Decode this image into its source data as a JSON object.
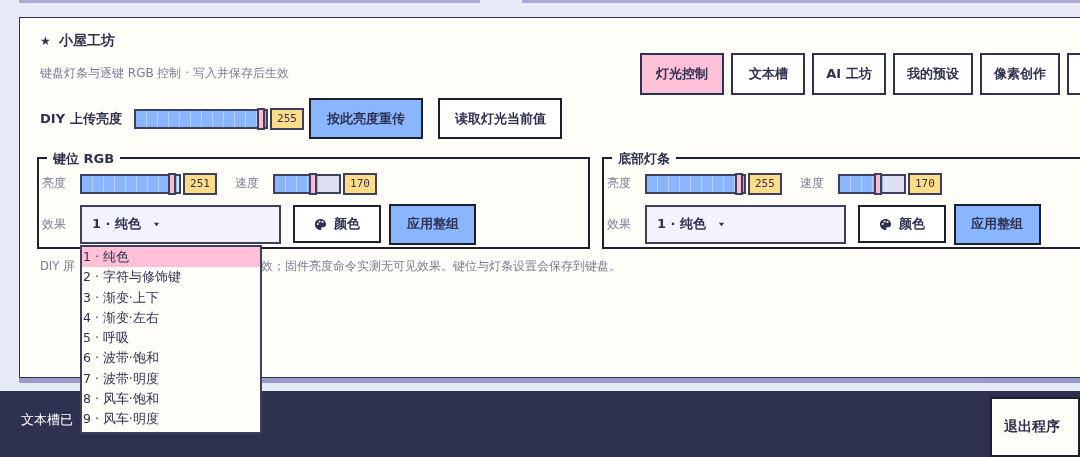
{
  "header": {
    "icon": "★",
    "title": "小屋工坊",
    "subtitle": "键盘灯条与逐键 RGB 控制 · 写入并保存后生效"
  },
  "tabs": [
    {
      "label": "灯光控制",
      "selected": true
    },
    {
      "label": "文本槽",
      "selected": false
    },
    {
      "label": "AI 工坊",
      "selected": false
    },
    {
      "label": "我的预设",
      "selected": false
    },
    {
      "label": "像素创作",
      "selected": false
    }
  ],
  "diy": {
    "label": "DIY 上传亮度",
    "level": 1.0,
    "value": "255",
    "buttons": [
      {
        "label": "按此亮度重传",
        "kind": "primary"
      },
      {
        "label": "读取灯光当前值",
        "kind": "plain"
      }
    ]
  },
  "groups": [
    {
      "title": "键位 RGB",
      "brightness": {
        "label": "亮度",
        "level": 0.984,
        "value": "251"
      },
      "speed": {
        "label": "速度",
        "level": 0.667,
        "value": "170"
      },
      "effect": {
        "label": "效果",
        "value": "1 · 纯色",
        "expanded": true
      },
      "color_button": "颜色",
      "apply_button": "应用整组"
    },
    {
      "title": "底部灯条",
      "brightness": {
        "label": "亮度",
        "level": 1.0,
        "value": "255"
      },
      "speed": {
        "label": "速度",
        "level": 0.667,
        "value": "170"
      },
      "effect": {
        "label": "效果",
        "value": "1 · 纯色",
        "expanded": false
      },
      "color_button": "颜色",
      "apply_button": "应用整组"
    }
  ],
  "dropdown": {
    "options": [
      {
        "label": "1 · 纯色",
        "selected": true
      },
      {
        "label": "2 · 字符与修饰键",
        "selected": false
      },
      {
        "label": "3 · 渐变·上下",
        "selected": false
      },
      {
        "label": "4 · 渐变·左右",
        "selected": false
      },
      {
        "label": "5 · 呼吸",
        "selected": false
      },
      {
        "label": "6 · 波带·饱和",
        "selected": false
      },
      {
        "label": "7 · 波带·明度",
        "selected": false
      },
      {
        "label": "8 · 风车·饱和",
        "selected": false
      },
      {
        "label": "9 · 风车·明度",
        "selected": false
      }
    ]
  },
  "note": [
    "DIY 屏",
    "效；固件亮度命令实测无可见效果。键位与灯条设置会保存到键盘。"
  ],
  "footer": {
    "status": "文本槽已",
    "button": "退出程序"
  }
}
